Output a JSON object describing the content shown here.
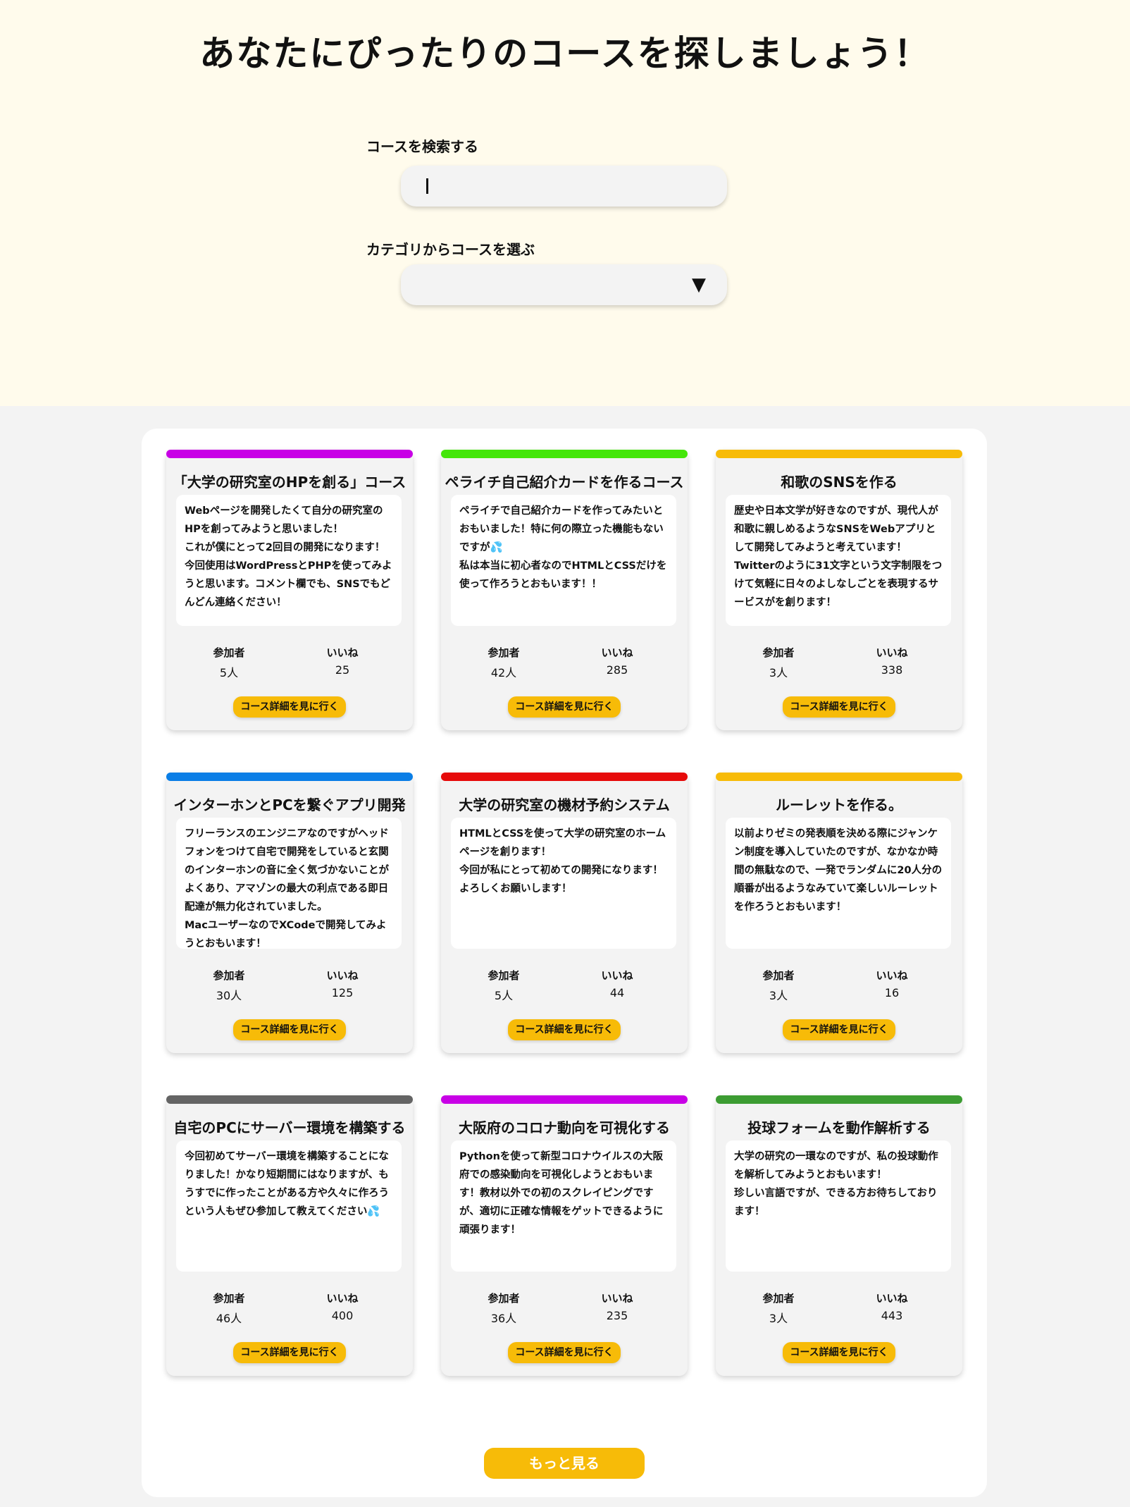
{
  "hero": {
    "title": "あなたにぴったりのコースを探しましょう！",
    "search_label": "コースを検索する",
    "search_value": "",
    "category_label": "カテゴリからコースを選ぶ",
    "category_selected": "",
    "select_arrow": "▼"
  },
  "common": {
    "participants_label": "参加者",
    "likes_label": "いいね",
    "detail_button": "コース詳細を見に行く"
  },
  "courses": [
    {
      "color": "#c800e6",
      "title": "「大学の研究室のHPを創る」コース",
      "description": "Webページを開発したくて自分の研究室のHPを創ってみようと思いました！\nこれが僕にとって2回目の開発になります！\n今回使用はWordPressとPHPを使ってみようと思います。コメント欄でも、SNSでもどんどん連絡ください！",
      "participants": "5人",
      "likes": "25"
    },
    {
      "color": "#44e60a",
      "title": "ペライチ自己紹介カードを作るコース",
      "description": "ペライチで自己紹介カードを作ってみたいとおもいました！特に何の際立った機能もないですが💦\n私は本当に初心者なのでHTMLとCSSだけを使って作ろうとおもいます！！",
      "participants": "42人",
      "likes": "285"
    },
    {
      "color": "#f7bb08",
      "title": "和歌のSNSを作る",
      "description": "歴史や日本文学が好きなのですが、現代人が和歌に親しめるようなSNSをWebアプリとして開発してみようと考えています！\nTwitterのように31文字という文字制限をつけて気軽に日々のよしなしごとを表現するサービスがを創ります！",
      "participants": "3人",
      "likes": "338"
    },
    {
      "color": "#0a7ee6",
      "title": "インターホンとPCを繋ぐアプリ開発",
      "description": "フリーランスのエンジニアなのですがヘッドフォンをつけて自宅で開発をしていると玄関のインターホンの音に全く気づかないことがよくあり、アマゾンの最大の利点である即日配達が無力化されていました。\nMacユーザーなのでXCodeで開発してみようとおもいます！",
      "participants": "30人",
      "likes": "125"
    },
    {
      "color": "#e60a0a",
      "title": "大学の研究室の機材予約システム",
      "description": "HTMLとCSSを使って大学の研究室のホームページを創ります！\n今回が私にとって初めての開発になります！\nよろしくお願いします！",
      "participants": "5人",
      "likes": "44"
    },
    {
      "color": "#f7bb08",
      "title": "ルーレットを作る。",
      "description": "以前よりゼミの発表順を決める際にジャンケン制度を導入していたのですが、なかなか時間の無駄なので、一発でランダムに20人分の順番が出るようなみていて楽しいルーレットを作ろうとおもいます！",
      "participants": "3人",
      "likes": "16"
    },
    {
      "color": "#646464",
      "title": "自宅のPCにサーバー環境を構築する",
      "description": "今回初めてサーバー環境を構築することになりました！かなり短期間にはなりますが、もうすでに作ったことがある方や久々に作ろうという人もぜひ参加して教えてください💦",
      "participants": "46人",
      "likes": "400"
    },
    {
      "color": "#c800e6",
      "title": "大阪府のコロナ動向を可視化する",
      "description": "Pythonを使って新型コロナウイルスの大阪府での感染動向を可視化しようとおもいます！教材以外での初のスクレイピングですが、適切に正確な情報をゲットできるように頑張ります！",
      "participants": "36人",
      "likes": "235"
    },
    {
      "color": "#3c9c32",
      "title": "投球フォームを動作解析する",
      "description": "大学の研究の一環なのですが、私の投球動作を解析してみようとおもいます！\n珍しい言語ですが、できる方お待ちしております！",
      "participants": "3人",
      "likes": "443"
    }
  ],
  "more_button": "もっと見る"
}
